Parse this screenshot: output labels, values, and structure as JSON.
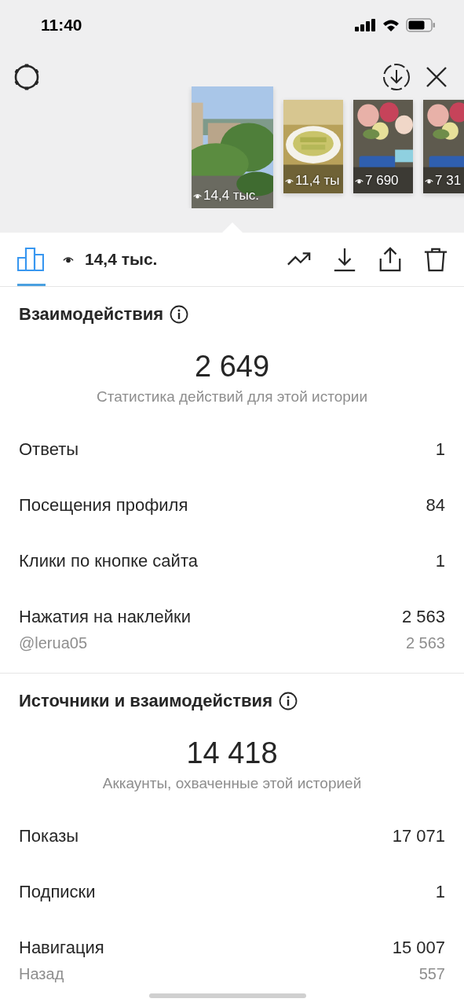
{
  "status_bar": {
    "time": "11:40"
  },
  "stories": [
    {
      "views": "14,4 тыс.",
      "selected": true
    },
    {
      "views": "11,4 ты",
      "selected": false
    },
    {
      "views": "7 690",
      "selected": false
    },
    {
      "views": "7 31",
      "selected": false
    }
  ],
  "toolbar": {
    "views": "14,4 тыс."
  },
  "sections": [
    {
      "title": "Взаимодействия",
      "total": "2 649",
      "caption": "Статистика действий для этой истории",
      "rows": [
        {
          "label": "Ответы",
          "value": "1",
          "kind": "main"
        },
        {
          "label": "Посещения профиля",
          "value": "84",
          "kind": "main"
        },
        {
          "label": "Клики по кнопке сайта",
          "value": "1",
          "kind": "main"
        },
        {
          "label": "Нажатия на наклейки",
          "value": "2 563",
          "kind": "main"
        },
        {
          "label": "@lerua05",
          "value": "2 563",
          "kind": "sub"
        }
      ]
    },
    {
      "title": "Источники и взаимодействия",
      "total": "14 418",
      "caption": "Аккаунты, охваченные этой историей",
      "rows": [
        {
          "label": "Показы",
          "value": "17 071",
          "kind": "main"
        },
        {
          "label": "Подписки",
          "value": "1",
          "kind": "main"
        },
        {
          "label": "Навигация",
          "value": "15 007",
          "kind": "main"
        },
        {
          "label": "Назад",
          "value": "557",
          "kind": "sub"
        }
      ]
    }
  ]
}
